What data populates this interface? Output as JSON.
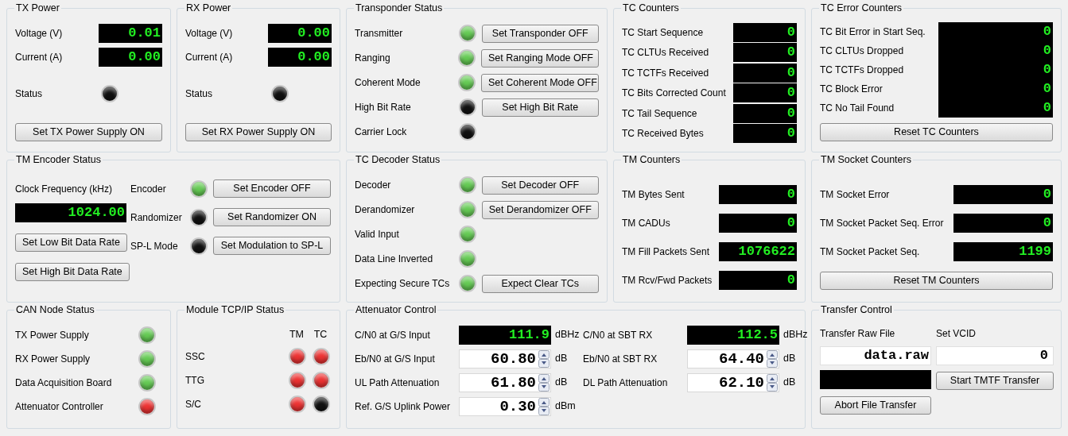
{
  "panels": [
    {
      "kind": "power",
      "title": "TX Power",
      "readings": [
        {
          "label": "Voltage (V)",
          "value": "0.01"
        },
        {
          "label": "Current (A)",
          "value": "0.00"
        }
      ],
      "status": {
        "label": "Status",
        "color": "#111111"
      },
      "button": "Set TX Power Supply ON"
    },
    {
      "kind": "power",
      "title": "RX Power",
      "readings": [
        {
          "label": "Voltage (V)",
          "value": "0.00"
        },
        {
          "label": "Current (A)",
          "value": "0.00"
        }
      ],
      "status": {
        "label": "Status",
        "color": "#111111"
      },
      "button": "Set RX Power Supply ON"
    },
    {
      "kind": "leds",
      "title": "Transponder Status",
      "rows": [
        {
          "label": "Transmitter",
          "color": "#66cc55",
          "button": "Set Transponder OFF"
        },
        {
          "label": "Ranging",
          "color": "#66cc55",
          "button": "Set Ranging Mode OFF"
        },
        {
          "label": "Coherent Mode",
          "color": "#66cc55",
          "button": "Set Coherent Mode OFF"
        },
        {
          "label": "High Bit Rate",
          "color": "#111111",
          "button": "Set High Bit Rate"
        },
        {
          "label": "Carrier Lock",
          "color": "#111111"
        }
      ]
    },
    {
      "kind": "counters",
      "title": "TC Counters",
      "rows": [
        {
          "label": "TC Start Sequence",
          "value": "0"
        },
        {
          "label": "TC CLTUs Received",
          "value": "0"
        },
        {
          "label": "TC TCTFs Received",
          "value": "0"
        },
        {
          "label": "TC Bits Corrected Count",
          "value": "0"
        },
        {
          "label": "TC Tail Sequence",
          "value": "0"
        },
        {
          "label": "TC Received Bytes",
          "value": "0"
        }
      ]
    },
    {
      "kind": "counters",
      "title": "TC Error Counters",
      "rows": [
        {
          "label": "TC Bit Error in Start Seq.",
          "value": "0"
        },
        {
          "label": "TC CLTUs Dropped",
          "value": "0"
        },
        {
          "label": "TC TCTFs Dropped",
          "value": "0"
        },
        {
          "label": "TC Block Error",
          "value": "0"
        },
        {
          "label": "TC No Tail Found",
          "value": "0"
        }
      ],
      "button": "Reset TC Counters"
    },
    {
      "kind": "encoder",
      "title": "TM Encoder Status",
      "clock_label": "Clock Frequency (kHz)",
      "clock_value": "1024.00",
      "rate_buttons": [
        "Set Low Bit Data Rate",
        "Set High Bit Data Rate"
      ],
      "rows": [
        {
          "label": "Encoder",
          "color": "#66cc55",
          "button": "Set Encoder OFF"
        },
        {
          "label": "Randomizer",
          "color": "#111111",
          "button": "Set Randomizer ON"
        },
        {
          "label": "SP-L Mode",
          "color": "#111111",
          "button": "Set Modulation to SP-L"
        }
      ]
    },
    {
      "kind": "leds",
      "title": "TC Decoder Status",
      "rows": [
        {
          "label": "Decoder",
          "color": "#66cc55",
          "button": "Set Decoder OFF"
        },
        {
          "label": "Derandomizer",
          "color": "#66cc55",
          "button": "Set Derandomizer OFF"
        },
        {
          "label": "Valid Input",
          "color": "#66cc55"
        },
        {
          "label": "Data Line Inverted",
          "color": "#66cc55"
        },
        {
          "label": "Expecting Secure TCs",
          "color": "#66cc55",
          "button": "Expect Clear TCs"
        }
      ]
    },
    {
      "kind": "counters",
      "title": "TM Counters",
      "rows": [
        {
          "label": "TM Bytes Sent",
          "value": "0"
        },
        {
          "label": "TM CADUs",
          "value": "0"
        },
        {
          "label": "TM Fill Packets Sent",
          "value": "1076622"
        },
        {
          "label": "TM Rcv/Fwd Packets",
          "value": "0"
        }
      ]
    },
    {
      "kind": "counters",
      "title": "TM Socket Counters",
      "rows": [
        {
          "label": "TM Socket Error",
          "value": "0"
        },
        {
          "label": "TM Socket Packet Seq. Error",
          "value": "0"
        },
        {
          "label": "TM Socket Packet Seq.",
          "value": "1199"
        }
      ],
      "button": "Reset TM Counters"
    },
    {
      "kind": "can",
      "title": "CAN Node Status",
      "rows": [
        {
          "label": "TX Power Supply",
          "color": "#66cc55"
        },
        {
          "label": "RX Power Supply",
          "color": "#66cc55"
        },
        {
          "label": "Data Acquisition Board",
          "color": "#66cc55"
        },
        {
          "label": "Attenuator Controller",
          "color": "#ee3333"
        }
      ]
    },
    {
      "kind": "tcpip",
      "title": "Module TCP/IP Status",
      "columns": [
        "TM",
        "TC"
      ],
      "rows": [
        {
          "label": "SSC",
          "leds": [
            {
              "color": "#ee3333"
            },
            {
              "color": "#ee3333"
            }
          ]
        },
        {
          "label": "TTG",
          "leds": [
            {
              "color": "#ee3333"
            },
            {
              "color": "#ee3333"
            }
          ]
        },
        {
          "label": "S/C",
          "leds": [
            {
              "color": "#ee3333"
            },
            {
              "color": "#111111"
            }
          ]
        }
      ]
    },
    {
      "kind": "attenuator",
      "title": "Attenuator Control",
      "items": [
        {
          "kind": "display",
          "label": "C/N0 at G/S Input",
          "value": "111.9",
          "unit": "dBHz"
        },
        {
          "kind": "display",
          "label": "C/N0 at SBT RX",
          "value": "112.5",
          "unit": "dBHz"
        },
        {
          "kind": "spin",
          "label": "Eb/N0 at G/S Input",
          "value": "60.80",
          "unit": "dB"
        },
        {
          "kind": "spin",
          "label": "Eb/N0 at SBT RX",
          "value": "64.40",
          "unit": "dB"
        },
        {
          "kind": "spin",
          "label": "UL Path Attenuation",
          "value": "61.80",
          "unit": "dB"
        },
        {
          "kind": "spin",
          "label": "DL Path Attenuation",
          "value": "62.10",
          "unit": "dB"
        },
        {
          "kind": "spin",
          "label": "Ref. G/S Uplink Power",
          "value": "0.30",
          "unit": "dBm"
        }
      ]
    },
    {
      "kind": "transfer",
      "title": "Transfer Control",
      "file_label": "Transfer Raw File",
      "file_value": "data.raw",
      "vcid_label": "Set VCID",
      "vcid_value": "0",
      "start_button": "Start TMTF Transfer",
      "abort_button": "Abort File Transfer"
    }
  ]
}
